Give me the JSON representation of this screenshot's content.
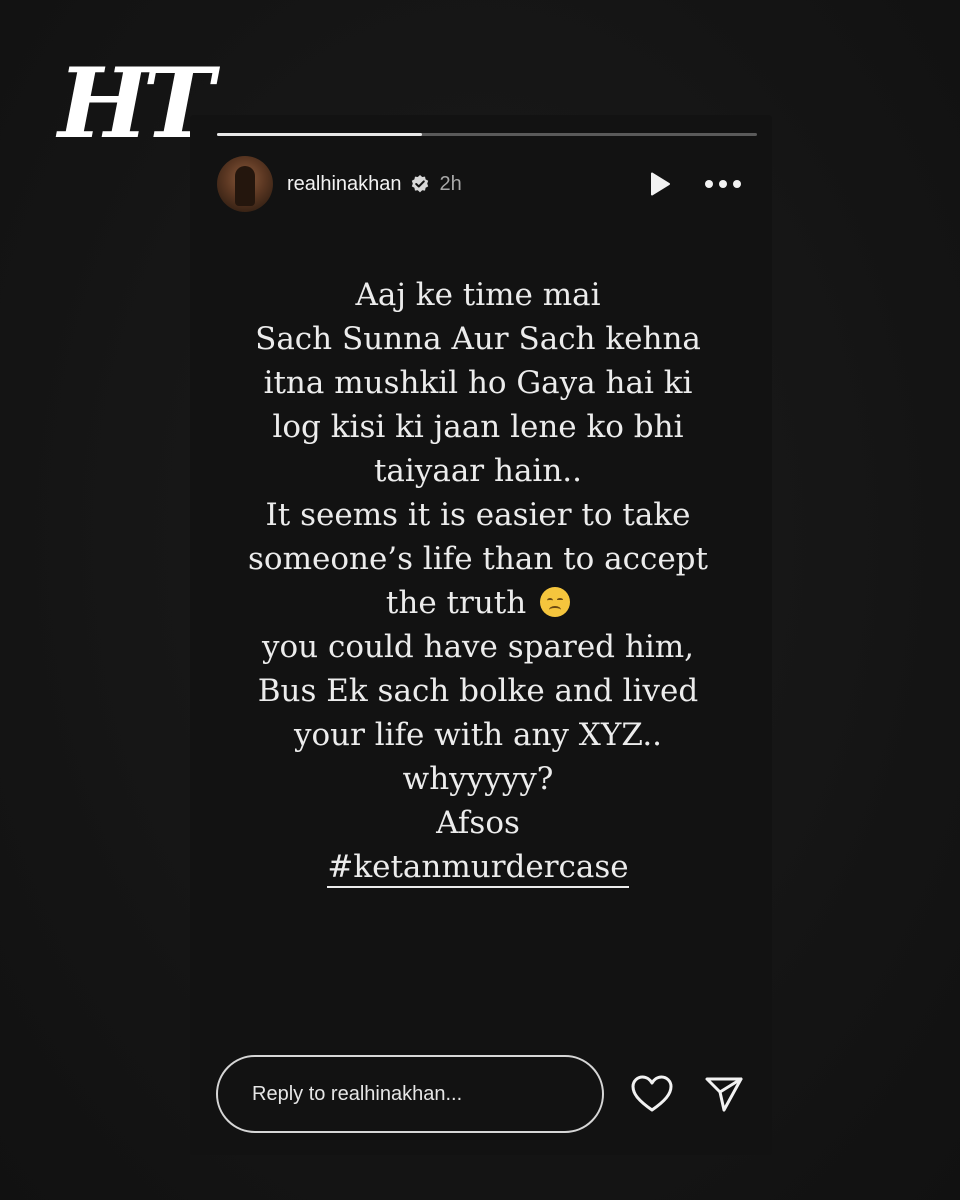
{
  "brand": {
    "logo_text": "HT"
  },
  "story": {
    "progress_fraction": 0.38,
    "header": {
      "username": "realhinakhan",
      "verified": true,
      "time_ago": "2h",
      "icons": {
        "play": "play-icon",
        "more": "more-horizontal-icon",
        "verified": "verified-badge-icon"
      }
    },
    "text_lines": [
      "Aaj ke time mai",
      "Sach Sunna Aur Sach kehna",
      "itna mushkil ho Gaya hai ki",
      "log kisi ki jaan lene ko bhi",
      "taiyaar hain..",
      "It seems it is easier to take",
      "someone’s life than to accept",
      "the truth",
      "you could have spared him,",
      "Bus Ek sach bolke and lived",
      "your life with any XYZ..",
      "whyyyyy?",
      "Afsos"
    ],
    "emoji_name": "disappointed-face-emoji",
    "hashtag": "#ketanmurdercase",
    "footer": {
      "reply_placeholder": "Reply to realhinakhan...",
      "icons": {
        "like": "heart-icon",
        "share": "send-icon"
      }
    }
  },
  "colors": {
    "background": "#151515",
    "card": "#121212",
    "text": "#ececec",
    "progress_track": "#5a5a5a",
    "progress_fill": "#e8e8e8"
  }
}
